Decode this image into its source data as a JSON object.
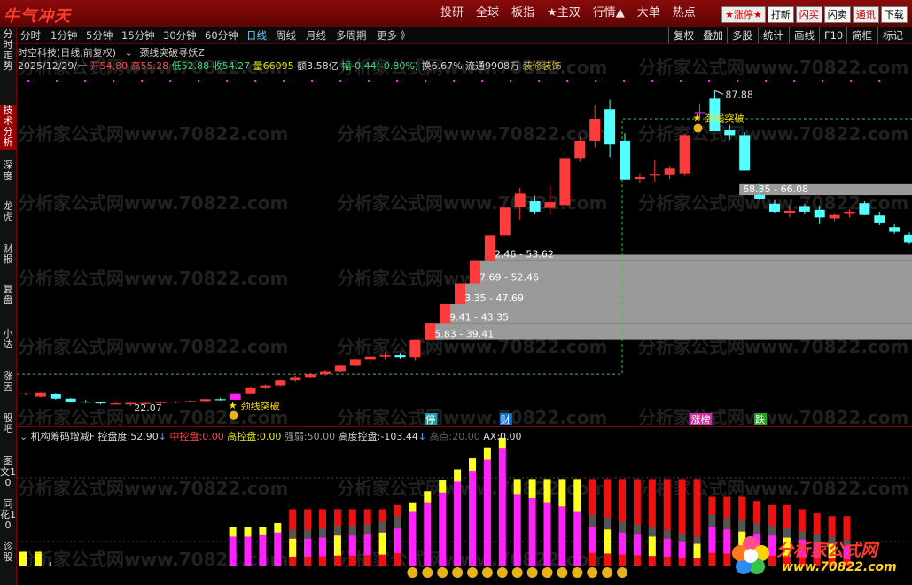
{
  "app": {
    "logo_text": "牛气冲天",
    "top_menu": [
      "投研",
      "全球",
      "板指",
      "★主双",
      "行情▲",
      "大单",
      "热点"
    ],
    "top_chips": [
      "★涨停★",
      "打新",
      "闪买",
      "闪卖",
      "通讯",
      "下载"
    ]
  },
  "left_nav": [
    "分时走势",
    "技术分析",
    "深度",
    "龙虎",
    "财报",
    "复盘",
    "小达",
    "涨因",
    "股吧",
    "图文10",
    "同花10",
    "诊股"
  ],
  "timeframes": [
    "分时",
    "1分钟",
    "5分钟",
    "15分钟",
    "30分钟",
    "60分钟",
    "日线",
    "周线",
    "月线",
    "多周期",
    "更多 》"
  ],
  "selected_timeframe": "日线",
  "right_tools": [
    "复权",
    "叠加",
    "多股",
    "统计",
    "画线",
    "F10",
    "简框",
    "标记"
  ],
  "stock_title": "时空科技(日线,前复权)",
  "indicator_name": "颈线突破寻妖Z",
  "quote": {
    "date": "2025/12/29/一",
    "open_label": "开",
    "open": "54.80",
    "high_label": "高",
    "high": "55.28",
    "low_label": "低",
    "low": "52.88",
    "close_label": "收",
    "close": "54.27",
    "volume": "量66095",
    "amount": "额3.58亿",
    "change": "幅-0.44(-0.80%)",
    "turnover": "换6.67%",
    "float": "流通9908万",
    "sector": "装修装饰"
  },
  "annotations": {
    "max_price": "87.88",
    "min_price": "22.07",
    "breakout_label": "颈线突破",
    "event_markers": [
      "停",
      "财",
      "涨榜",
      "跌"
    ]
  },
  "sub_indicator": {
    "name": "机构筹码增减F",
    "kp_label": "控盘度:",
    "kp_value": "52.90",
    "mid_label": "中控盘:",
    "mid_value": "0.00",
    "high_label": "高控盘:",
    "high_value": "0.00",
    "weak_label": "强弱:",
    "weak_value": "50.00",
    "height_label": "高度控盘:",
    "height_value": "-103.44",
    "hp_label": "高点:",
    "hp_value": "20.00",
    "ax_label": "AX:",
    "ax_value": "0.00"
  },
  "watermark": {
    "text": "分析家公式网www.70822.com",
    "brand_name": "分析家公式网",
    "brand_url": "www.70822.com"
  },
  "colors": {
    "up": "#ff3b3b",
    "down": "#54ffff",
    "zone": "#9a9a9a",
    "magenta": "#ff22ff",
    "yellow": "#ffff22",
    "dashed": "#33cc33"
  },
  "chart_data": {
    "type": "candlestick",
    "candles": [
      {
        "o": 24.6,
        "h": 24.9,
        "l": 24.2,
        "c": 24.7
      },
      {
        "o": 24.0,
        "h": 25.0,
        "l": 23.8,
        "c": 24.9
      },
      {
        "o": 24.6,
        "h": 24.8,
        "l": 23.4,
        "c": 23.6
      },
      {
        "o": 23.6,
        "h": 23.7,
        "l": 22.9,
        "c": 23.0
      },
      {
        "o": 23.0,
        "h": 23.3,
        "l": 22.7,
        "c": 22.9
      },
      {
        "o": 22.9,
        "h": 23.0,
        "l": 22.4,
        "c": 22.6
      },
      {
        "o": 22.5,
        "h": 22.8,
        "l": 22.4,
        "c": 22.6
      },
      {
        "o": 22.4,
        "h": 22.9,
        "l": 22.07,
        "c": 22.7
      },
      {
        "o": 22.5,
        "h": 22.8,
        "l": 22.3,
        "c": 22.7
      },
      {
        "o": 22.7,
        "h": 23.0,
        "l": 22.5,
        "c": 22.9
      },
      {
        "o": 22.8,
        "h": 23.1,
        "l": 22.6,
        "c": 23.0
      },
      {
        "o": 23.0,
        "h": 23.3,
        "l": 22.9,
        "c": 23.1
      },
      {
        "o": 23.1,
        "h": 23.6,
        "l": 23.0,
        "c": 23.5
      },
      {
        "o": 23.5,
        "h": 23.8,
        "l": 23.2,
        "c": 23.4
      },
      {
        "o": 23.4,
        "h": 24.8,
        "l": 23.3,
        "c": 24.7
      },
      {
        "o": 24.7,
        "h": 25.9,
        "l": 24.5,
        "c": 25.8
      },
      {
        "o": 25.8,
        "h": 26.6,
        "l": 25.6,
        "c": 26.4
      },
      {
        "o": 26.4,
        "h": 27.5,
        "l": 26.2,
        "c": 27.4
      },
      {
        "o": 27.4,
        "h": 28.4,
        "l": 27.1,
        "c": 28.1
      },
      {
        "o": 28.1,
        "h": 28.9,
        "l": 27.9,
        "c": 28.7
      },
      {
        "o": 28.7,
        "h": 29.5,
        "l": 28.4,
        "c": 29.2
      },
      {
        "o": 29.2,
        "h": 30.6,
        "l": 29.0,
        "c": 30.5
      },
      {
        "o": 30.5,
        "h": 32.0,
        "l": 30.3,
        "c": 31.8
      },
      {
        "o": 31.8,
        "h": 32.5,
        "l": 31.0,
        "c": 32.3
      },
      {
        "o": 32.3,
        "h": 33.3,
        "l": 31.8,
        "c": 32.6
      },
      {
        "o": 32.6,
        "h": 33.1,
        "l": 31.9,
        "c": 32.2
      },
      {
        "o": 32.2,
        "h": 35.9,
        "l": 31.6,
        "c": 35.8
      },
      {
        "o": 35.83,
        "h": 39.41,
        "l": 35.83,
        "c": 39.41
      },
      {
        "o": 39.41,
        "h": 43.35,
        "l": 39.41,
        "c": 43.35
      },
      {
        "o": 43.35,
        "h": 47.69,
        "l": 43.35,
        "c": 47.69
      },
      {
        "o": 47.69,
        "h": 52.46,
        "l": 47.69,
        "c": 52.46
      },
      {
        "o": 52.46,
        "h": 57.71,
        "l": 52.46,
        "c": 57.71
      },
      {
        "o": 57.71,
        "h": 63.48,
        "l": 57.71,
        "c": 63.48
      },
      {
        "o": 63.5,
        "h": 67.6,
        "l": 61.0,
        "c": 66.4
      },
      {
        "o": 64.8,
        "h": 66.0,
        "l": 62.2,
        "c": 62.6
      },
      {
        "o": 63.4,
        "h": 68.0,
        "l": 62.0,
        "c": 64.6
      },
      {
        "o": 64.0,
        "h": 74.6,
        "l": 63.5,
        "c": 73.8
      },
      {
        "o": 73.8,
        "h": 78.2,
        "l": 73.0,
        "c": 77.4
      },
      {
        "o": 77.4,
        "h": 84.8,
        "l": 76.0,
        "c": 82.0
      },
      {
        "o": 84.0,
        "h": 86.0,
        "l": 74.0,
        "c": 76.6
      },
      {
        "o": 77.4,
        "h": 79.0,
        "l": 69.3,
        "c": 69.3
      },
      {
        "o": 69.4,
        "h": 70.6,
        "l": 68.6,
        "c": 69.8
      },
      {
        "o": 70.1,
        "h": 73.4,
        "l": 68.9,
        "c": 70.5
      },
      {
        "o": 70.4,
        "h": 72.2,
        "l": 69.4,
        "c": 71.6
      },
      {
        "o": 70.6,
        "h": 78.8,
        "l": 70.1,
        "c": 78.6
      },
      {
        "o": 83.4,
        "h": 85.2,
        "l": 81.8,
        "c": 83.4
      },
      {
        "o": 86.2,
        "h": 87.88,
        "l": 79.4,
        "c": 79.4
      },
      {
        "o": 79.6,
        "h": 80.8,
        "l": 77.6,
        "c": 78.6
      },
      {
        "o": 78.6,
        "h": 79.2,
        "l": 71.2,
        "c": 71.2
      },
      {
        "o": 66.1,
        "h": 68.4,
        "l": 65.0,
        "c": 65.2
      },
      {
        "o": 64.3,
        "h": 65.0,
        "l": 62.4,
        "c": 62.6
      },
      {
        "o": 62.4,
        "h": 64.0,
        "l": 61.4,
        "c": 62.8
      },
      {
        "o": 63.8,
        "h": 64.2,
        "l": 62.2,
        "c": 62.6
      },
      {
        "o": 63.0,
        "h": 63.9,
        "l": 60.0,
        "c": 61.4
      },
      {
        "o": 61.2,
        "h": 62.3,
        "l": 60.7,
        "c": 61.9
      },
      {
        "o": 62.3,
        "h": 63.1,
        "l": 61.4,
        "c": 62.6
      },
      {
        "o": 64.4,
        "h": 64.8,
        "l": 61.9,
        "c": 61.9
      },
      {
        "o": 61.8,
        "h": 62.6,
        "l": 59.8,
        "c": 60.2
      },
      {
        "o": 59.4,
        "h": 60.0,
        "l": 58.0,
        "c": 58.4
      },
      {
        "o": 57.8,
        "h": 58.3,
        "l": 55.9,
        "c": 56.2
      },
      {
        "o": 54.8,
        "h": 55.28,
        "l": 52.88,
        "c": 54.27
      }
    ],
    "zones": [
      {
        "low": 35.83,
        "high": 39.41,
        "label": "35.83 - 39.41",
        "start": 27
      },
      {
        "low": 39.41,
        "high": 43.35,
        "label": "39.41 - 43.35",
        "start": 28
      },
      {
        "low": 43.35,
        "high": 47.69,
        "label": "43.35 - 47.69",
        "start": 29
      },
      {
        "low": 47.69,
        "high": 52.46,
        "label": "47.69 - 52.46",
        "start": 30
      },
      {
        "low": 52.46,
        "high": 53.62,
        "label": "52.46 - 53.62",
        "start": 31
      },
      {
        "low": 66.08,
        "high": 68.35,
        "label": "68.35 - 66.08",
        "start": 48
      }
    ],
    "neckline": {
      "levels": [
        28.7,
        82.0
      ],
      "break_index": 40
    },
    "breakouts": [
      14,
      45
    ],
    "volume_bars": [
      {
        "t": 1.0,
        "b": 0.9,
        "k": "y"
      },
      {
        "t": 1.0,
        "b": 0.85,
        "k": "y"
      },
      {
        "t": 0.25,
        "b": 0.0,
        "k": "n"
      },
      {
        "t": 0.0,
        "b": 0.0,
        "k": "n"
      },
      {
        "t": 0.0,
        "b": 0.0,
        "k": "n"
      },
      {
        "t": 0.0,
        "b": 0.0,
        "k": "n"
      },
      {
        "t": 0.0,
        "b": 0.0,
        "k": "n"
      },
      {
        "t": 0.0,
        "b": 0.0,
        "k": "n"
      },
      {
        "t": 0.0,
        "b": 0.0,
        "k": "n"
      },
      {
        "t": 0.0,
        "b": 0.0,
        "k": "n"
      },
      {
        "t": 0.0,
        "b": 0.0,
        "k": "n"
      },
      {
        "t": 0.0,
        "b": 0.0,
        "k": "n"
      },
      {
        "t": 0.0,
        "b": 0.0,
        "k": "n"
      },
      {
        "t": 0.0,
        "b": 0.0,
        "k": "n"
      },
      {
        "t": 2.8,
        "b": 2.1,
        "k": "m"
      },
      {
        "t": 2.8,
        "b": 2.1,
        "k": "m"
      },
      {
        "t": 2.8,
        "b": 2.2,
        "k": "m"
      },
      {
        "t": 3.1,
        "b": 2.4,
        "k": "m"
      },
      {
        "t": 4.1,
        "b": 2.6,
        "k": "r"
      },
      {
        "t": 4.1,
        "b": 2.6,
        "k": "r"
      },
      {
        "t": 4.1,
        "b": 2.7,
        "k": "r"
      },
      {
        "t": 4.1,
        "b": 2.9,
        "k": "r"
      },
      {
        "t": 4.1,
        "b": 2.9,
        "k": "r"
      },
      {
        "t": 4.1,
        "b": 3.0,
        "k": "r"
      },
      {
        "t": 4.1,
        "b": 3.2,
        "k": "r"
      },
      {
        "t": 4.4,
        "b": 3.6,
        "k": "r"
      },
      {
        "t": 4.6,
        "b": 3.9,
        "k": "m"
      },
      {
        "t": 5.4,
        "b": 4.6,
        "k": "m"
      },
      {
        "t": 6.2,
        "b": 5.3,
        "k": "m"
      },
      {
        "t": 7.0,
        "b": 6.1,
        "k": "m"
      },
      {
        "t": 7.8,
        "b": 6.9,
        "k": "m"
      },
      {
        "t": 8.6,
        "b": 7.7,
        "k": "m"
      },
      {
        "t": 9.3,
        "b": 8.5,
        "k": "m"
      },
      {
        "t": 6.3,
        "b": 5.2,
        "k": "m"
      },
      {
        "t": 6.3,
        "b": 4.9,
        "k": "m"
      },
      {
        "t": 6.3,
        "b": 4.6,
        "k": "m"
      },
      {
        "t": 6.3,
        "b": 4.3,
        "k": "m"
      },
      {
        "t": 6.3,
        "b": 3.9,
        "k": "m"
      },
      {
        "t": 6.3,
        "b": 3.7,
        "k": "r"
      },
      {
        "t": 6.3,
        "b": 3.5,
        "k": "r"
      },
      {
        "t": 6.3,
        "b": 3.2,
        "k": "r"
      },
      {
        "t": 6.3,
        "b": 3.0,
        "k": "r"
      },
      {
        "t": 6.3,
        "b": 2.8,
        "k": "r"
      },
      {
        "t": 6.3,
        "b": 2.6,
        "k": "r"
      },
      {
        "t": 6.3,
        "b": 2.3,
        "k": "r"
      },
      {
        "t": 6.3,
        "b": 2.1,
        "k": "r"
      },
      {
        "t": 5.0,
        "b": 3.7,
        "k": "r"
      },
      {
        "t": 5.0,
        "b": 3.5,
        "k": "r"
      },
      {
        "t": 5.0,
        "b": 3.3,
        "k": "r"
      },
      {
        "t": 4.7,
        "b": 3.1,
        "k": "r"
      },
      {
        "t": 4.4,
        "b": 2.9,
        "k": "r"
      },
      {
        "t": 4.4,
        "b": 2.7,
        "k": "r"
      },
      {
        "t": 4.1,
        "b": 2.5,
        "k": "r"
      },
      {
        "t": 3.8,
        "b": 2.3,
        "k": "r"
      },
      {
        "t": 3.6,
        "b": 2.1,
        "k": "r"
      },
      {
        "t": 3.6,
        "b": 1.9,
        "k": "r"
      }
    ],
    "smileys": [
      26,
      27,
      28,
      29,
      30,
      31,
      32,
      33,
      34,
      35,
      36,
      37,
      38,
      39,
      40
    ]
  }
}
